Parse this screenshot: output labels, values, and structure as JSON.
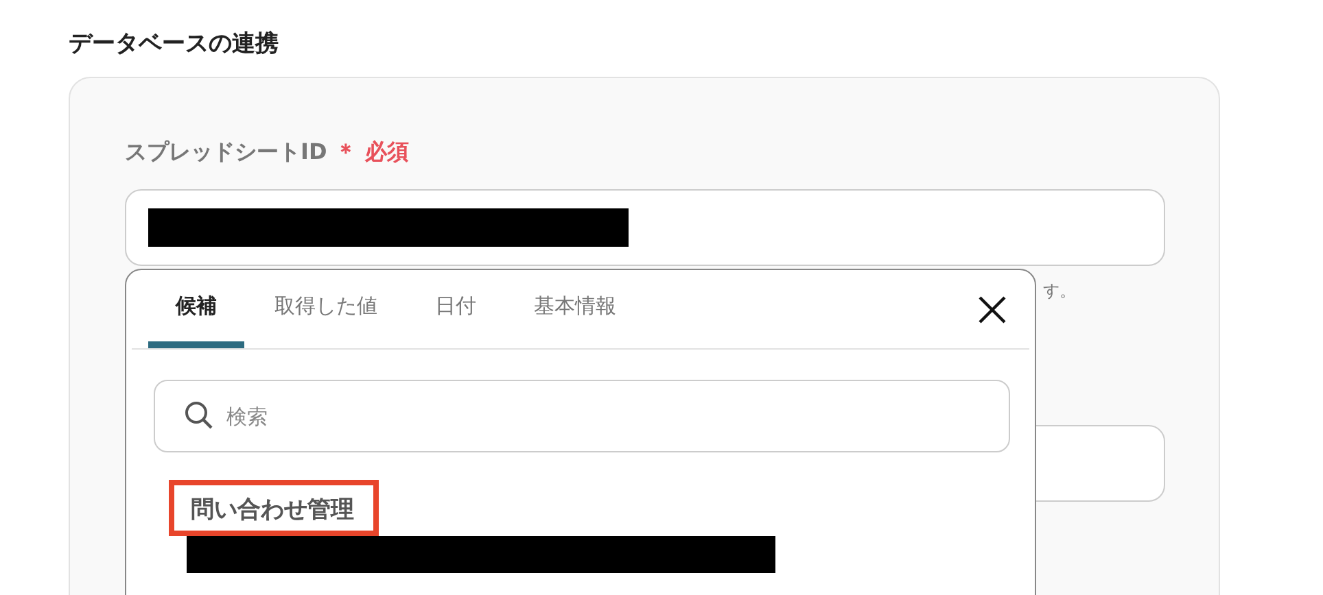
{
  "section_title": "データベースの連携",
  "spreadsheet_field": {
    "label": "スプレッドシートID",
    "required_mark": "＊",
    "required_label": "必須",
    "value_redacted": true,
    "hint": "す。"
  },
  "popup": {
    "tabs": [
      {
        "label": "候補",
        "selected": true
      },
      {
        "label": "取得した値",
        "selected": false
      },
      {
        "label": "日付",
        "selected": false
      },
      {
        "label": "基本情報",
        "selected": false
      }
    ],
    "search": {
      "placeholder": "検索"
    },
    "items": [
      {
        "title": "問い合わせ管理",
        "highlighted": true,
        "detail_redacted": true
      }
    ]
  }
}
